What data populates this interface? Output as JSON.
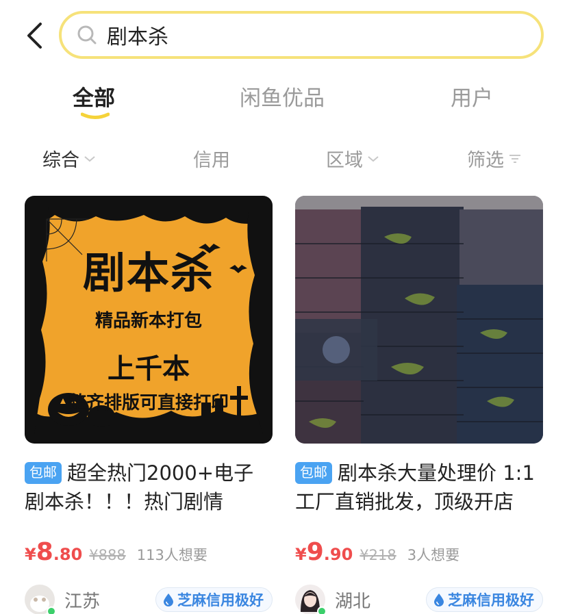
{
  "search": {
    "query": "剧本杀"
  },
  "tabs": [
    {
      "label": "全部",
      "active": true
    },
    {
      "label": "闲鱼优品",
      "active": false
    },
    {
      "label": "用户",
      "active": false
    }
  ],
  "filters": [
    {
      "label": "综合",
      "active": true
    },
    {
      "label": "信用",
      "active": false
    },
    {
      "label": "区域",
      "active": false
    },
    {
      "label": "筛选",
      "active": false
    }
  ],
  "colors": {
    "accent_yellow": "#f6e27a",
    "price_red": "#ef4d4d",
    "badge_blue": "#4aa3f2",
    "credit_blue": "#3a86e0"
  },
  "products": [
    {
      "badge": "包邮",
      "title": "超全热门2000+电子剧本杀！！！热门剧情",
      "currency": "¥",
      "price_int": "8",
      "price_dec": ".80",
      "orig_price": "¥888",
      "wants": "113人想要",
      "location": "江苏",
      "credit": "芝麻信用极好",
      "poster": {
        "title": "剧本杀",
        "sub": "精品新本打包",
        "big": "上千本",
        "foot": "整齐排版可直接打印"
      }
    },
    {
      "badge": "包邮",
      "title": "剧本杀大量处理价 1:1工厂直销批发，顶级开店",
      "currency": "¥",
      "price_int": "9",
      "price_dec": ".90",
      "orig_price": "¥218",
      "wants": "3人想要",
      "location": "湖北",
      "credit": "芝麻信用极好"
    }
  ]
}
